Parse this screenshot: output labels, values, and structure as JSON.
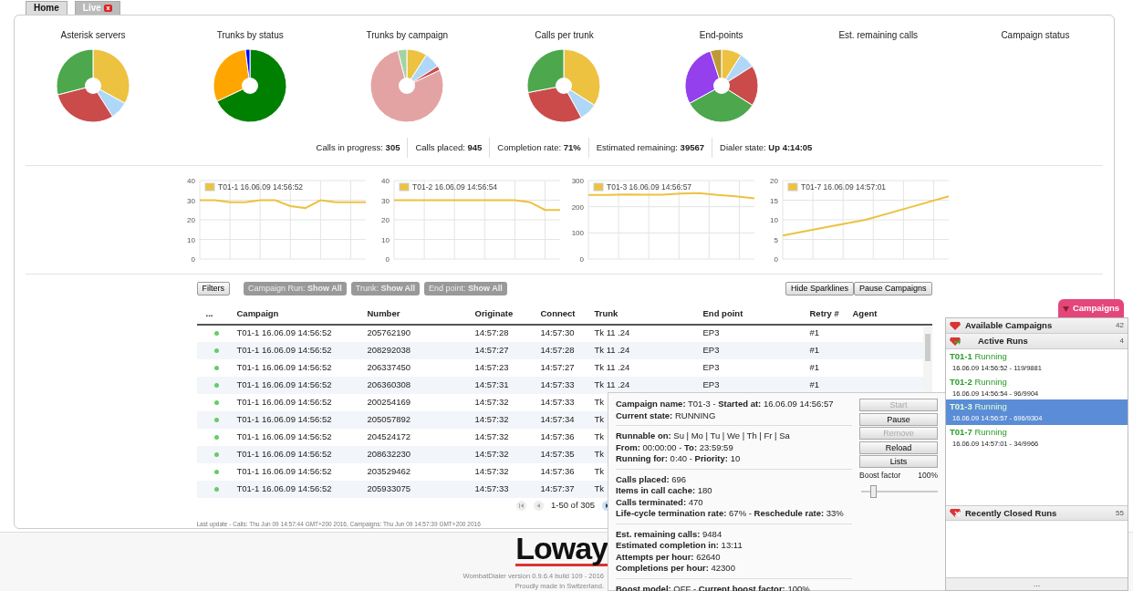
{
  "tabs": [
    {
      "label": "Home",
      "selected": true
    },
    {
      "label": "Live",
      "selected": false
    }
  ],
  "pies": [
    {
      "title": "Asterisk servers",
      "kind": "pie"
    },
    {
      "title": "Trunks by status",
      "kind": "pie"
    },
    {
      "title": "Trunks by campaign",
      "kind": "pie"
    },
    {
      "title": "Calls per trunk",
      "kind": "pie"
    },
    {
      "title": "End-points",
      "kind": "pie"
    },
    {
      "title": "Est. remaining calls",
      "kind": "empty"
    },
    {
      "title": "Campaign status",
      "kind": "empty"
    }
  ],
  "stats": [
    "Calls in progress: **305**",
    "Calls placed: **945**",
    "Completion rate: **71%**",
    "Estimated remaining: **39567**",
    "Dialer state: **Up 4:14:05**"
  ],
  "sparklines": [
    {
      "chart_data": {
        "type": "line",
        "grid": true,
        "ylim": [
          0,
          40
        ],
        "yticks": [
          0,
          10,
          20,
          30,
          40
        ],
        "series": [
          {
            "name": "T01-1 16.06.09 14:56:52",
            "color": "#edc240",
            "values": [
              30,
              30,
              29,
              29,
              30,
              30,
              27,
              26,
              30,
              29,
              29,
              29
            ]
          }
        ]
      }
    },
    {
      "chart_data": {
        "type": "line",
        "grid": true,
        "ylim": [
          0,
          40
        ],
        "yticks": [
          0,
          10,
          20,
          30,
          40
        ],
        "series": [
          {
            "name": "T01-2 16.06.09 14:56:54",
            "color": "#edc240",
            "values": [
              30,
              30,
              30,
              30,
              30,
              30,
              30,
              30,
              30,
              29,
              25,
              25
            ]
          }
        ]
      }
    },
    {
      "chart_data": {
        "type": "line",
        "grid": true,
        "ylim": [
          0,
          300
        ],
        "yticks": [
          0,
          100,
          200,
          300
        ],
        "series": [
          {
            "name": "T01-3 16.06.09 14:56:57",
            "color": "#edc240",
            "values": [
              245,
              245,
              247,
              246,
              246,
              250,
              252,
              245,
              240,
              232
            ]
          }
        ]
      }
    },
    {
      "chart_data": {
        "type": "line",
        "grid": true,
        "ylim": [
          0,
          20
        ],
        "yticks": [
          0,
          5,
          10,
          15,
          20
        ],
        "series": [
          {
            "name": "T01-7 16.06.09 14:57:01",
            "color": "#edc240",
            "values": [
              6,
              8,
              10,
              13,
              16
            ]
          }
        ]
      }
    }
  ],
  "filters": {
    "button": "Filters",
    "chips": [
      "Campaign Run: **Show All**",
      "Trunk: **Show All**",
      "End point: **Show All**"
    ],
    "actions": [
      "Hide Sparklines",
      "Pause Campaigns"
    ]
  },
  "table": {
    "status_header": "...",
    "columns": [
      "Campaign",
      "Number",
      "Originate",
      "Connect",
      "Trunk",
      "End point",
      "Retry #",
      "Agent"
    ],
    "rows": [
      [
        "T01-1 16.06.09 14:56:52",
        "205762190",
        "14:57:28",
        "14:57:30",
        "Tk 11 .24",
        "EP3",
        "#1"
      ],
      [
        "T01-1 16.06.09 14:56:52",
        "208292038",
        "14:57:27",
        "14:57:28",
        "Tk 11 .24",
        "EP3",
        "#1"
      ],
      [
        "T01-1 16.06.09 14:56:52",
        "206337450",
        "14:57:23",
        "14:57:27",
        "Tk 11 .24",
        "EP3",
        "#1"
      ],
      [
        "T01-1 16.06.09 14:56:52",
        "206360308",
        "14:57:31",
        "14:57:33",
        "Tk 11 .24",
        "EP3",
        "#1"
      ],
      [
        "T01-1 16.06.09 14:56:52",
        "200254169",
        "14:57:32",
        "14:57:33",
        "Tk"
      ],
      [
        "T01-1 16.06.09 14:56:52",
        "205057892",
        "14:57:32",
        "14:57:34",
        "Tk"
      ],
      [
        "T01-1 16.06.09 14:56:52",
        "204524172",
        "14:57:32",
        "14:57:36",
        "Tk"
      ],
      [
        "T01-1 16.06.09 14:56:52",
        "208632230",
        "14:57:32",
        "14:57:35",
        "Tk"
      ],
      [
        "T01-1 16.06.09 14:56:52",
        "203529462",
        "14:57:32",
        "14:57:36",
        "Tk"
      ],
      [
        "T01-1 16.06.09 14:56:52",
        "205933075",
        "14:57:33",
        "14:57:37",
        "Tk"
      ]
    ]
  },
  "pager": "1-50 of 305",
  "last_update": "Last update - Calls: Thu Jun 09 14:57:44 GMT+200 2016, Campaigns: Thu Jun 09 14:57:39 GMT+200 2016",
  "footer": {
    "logo": "Loway",
    "version": "WombatDialer version 0.9.6.4 build 109 - 2016",
    "made": "Proudly made in Switzerland."
  },
  "popup": {
    "groups": [
      [
        "**Campaign name:** T01-3 - **Started at:** 16.06.09 14:56:57",
        "**Current state:** RUNNING"
      ],
      [
        "**Runnable on:** Su | Mo | Tu | We | Th | Fr | Sa",
        "**From:** 00:00:00 - **To:** 23:59:59",
        "**Running for:** 0:40 - **Priority:** 10"
      ],
      [
        "**Calls placed:** 696",
        "**Items in call cache:** 180",
        "**Calls terminated:** 470",
        "**Life-cycle termination rate:** 67% - **Reschedule rate:** 33%"
      ],
      [
        "**Est. remaining calls:** 9484",
        "**Estimated completion in:** 13:11",
        "**Attempts per hour:** 62640",
        "**Completions per hour:** 42300"
      ],
      [
        "**Boost model:** OFF - **Current boost factor:** 100%"
      ]
    ],
    "buttons": [
      {
        "label": "Start",
        "disabled": true
      },
      {
        "label": "Pause",
        "disabled": false
      },
      {
        "label": "Remove",
        "disabled": true
      },
      {
        "label": "Reload",
        "disabled": false
      },
      {
        "label": "Lists",
        "disabled": false
      }
    ],
    "boost": {
      "label": "Boost factor",
      "reading": "100%",
      "level": 0.12
    }
  },
  "panel": {
    "tab": "Campaigns",
    "sections": [
      {
        "title": "Available Campaigns",
        "count": "42",
        "kind": "available"
      },
      {
        "title": "Active Runs",
        "count": "4",
        "kind": "active",
        "runs": [
          {
            "name": "T01-1",
            "status": "Running",
            "detail": "16.06.09 14:56:52 - 119/9881",
            "selected": false
          },
          {
            "name": "T01-2",
            "status": "Running",
            "detail": "16.06.09 14:56:54 - 96/9904",
            "selected": false
          },
          {
            "name": "T01-3",
            "status": "Running",
            "detail": "16.06.09 14:56:57 - 696/9304",
            "selected": true
          },
          {
            "name": "T01-7",
            "status": "Running",
            "detail": "16.06.09 14:57:01 - 34/9966",
            "selected": false
          }
        ]
      },
      {
        "title": "Recently Closed Runs",
        "count": "55",
        "kind": "closed"
      }
    ],
    "more": "..."
  }
}
